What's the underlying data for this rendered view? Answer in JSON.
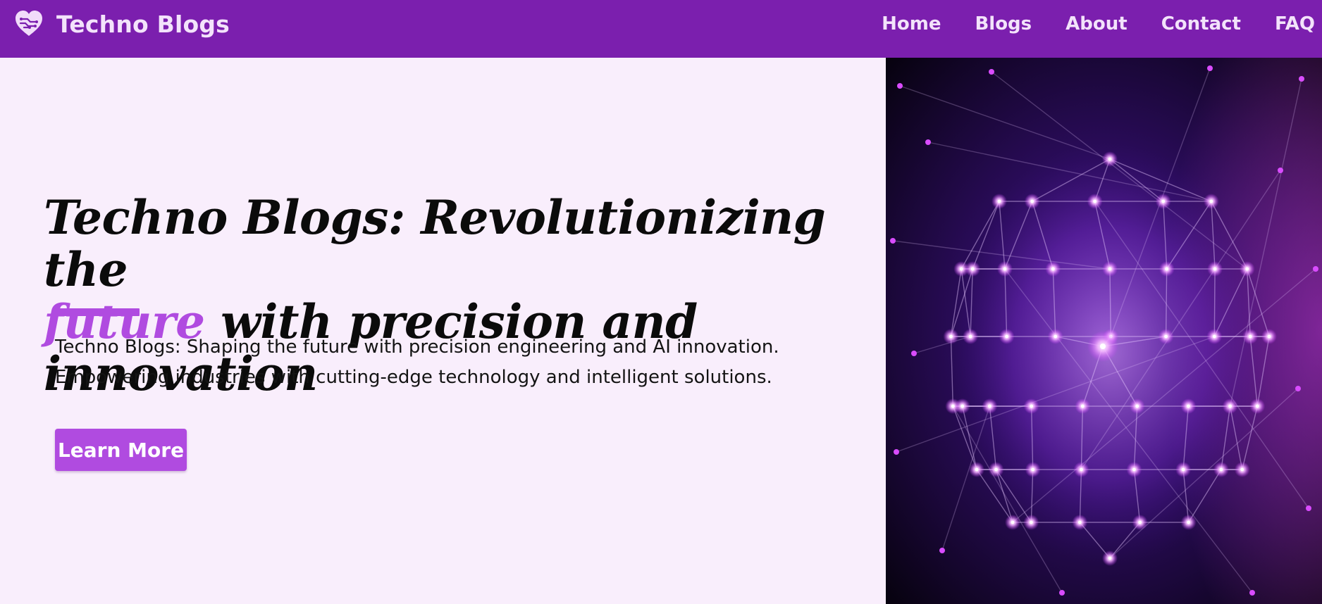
{
  "navbar": {
    "brand_name": "Techno Blogs",
    "brand_icon": "heart-circuit-icon",
    "links": [
      {
        "label": "Home"
      },
      {
        "label": "Blogs"
      },
      {
        "label": "About"
      },
      {
        "label": "Contact"
      },
      {
        "label": "FAQ"
      }
    ]
  },
  "hero": {
    "headline_part1": "Techno Blogs: Revolutionizing the",
    "headline_accent": "future",
    "headline_part2": " with precision and innovation",
    "description_line1": "Techno Blogs: Shaping the future with precision engineering and AI innovation.",
    "description_line2": "Empowering industries with cutting-edge technology and intelligent solutions.",
    "cta_label": "Learn More",
    "image_subject": "glowing-network-sphere"
  },
  "colors": {
    "navbar_bg": "#7b1fae",
    "accent": "#b04be0",
    "page_bg": "#f9eefc",
    "nav_text": "#f3e3fb"
  }
}
